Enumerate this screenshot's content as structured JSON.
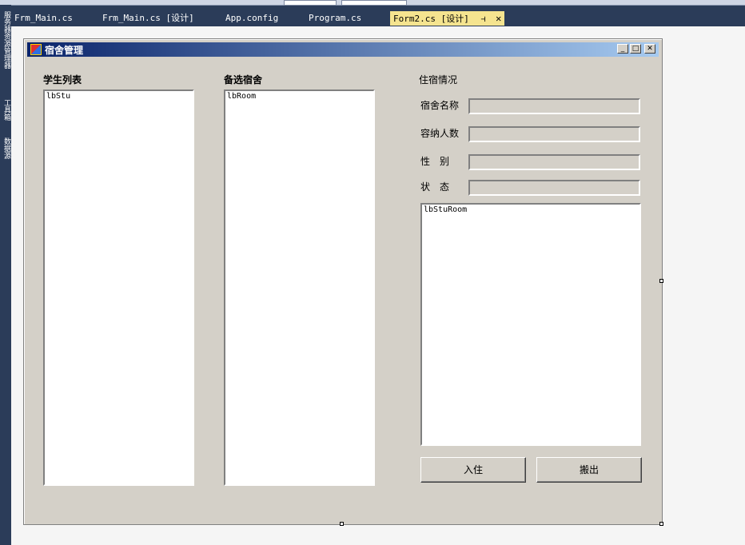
{
  "ide": {
    "tabs": [
      {
        "label": "Frm_Main.cs"
      },
      {
        "label": "Frm_Main.cs [设计]"
      },
      {
        "label": "App.config"
      },
      {
        "label": "Program.cs"
      },
      {
        "label": "Form2.cs [设计]"
      }
    ],
    "side_labels": [
      "服务器资源管理器",
      "工具箱",
      "数据源"
    ],
    "pin_glyph": "⊣",
    "close_glyph": "✕"
  },
  "form": {
    "title": "宿舍管理",
    "caption_buttons": {
      "minimize": "_",
      "maximize": "□",
      "close": "✕"
    },
    "student_list": {
      "label": "学生列表",
      "item": "lbStu"
    },
    "room_list": {
      "label": "备选宿舍",
      "item": "lbRoom"
    },
    "info": {
      "group_label": "住宿情况",
      "fields": [
        {
          "label": "宿舍名称",
          "value": ""
        },
        {
          "label": "容纳人数",
          "value": ""
        },
        {
          "label": "性　别",
          "value": ""
        },
        {
          "label": "状　态",
          "value": ""
        }
      ],
      "occupants_item": "lbStuRoom"
    },
    "buttons": {
      "checkin": "入住",
      "checkout": "搬出"
    }
  },
  "colors": {
    "ide_dark": "#2b3c59",
    "form_bg": "#d4d0c8",
    "title_start": "#0a246a",
    "title_end": "#a6caf0",
    "active_tab": "#f5e48f"
  }
}
